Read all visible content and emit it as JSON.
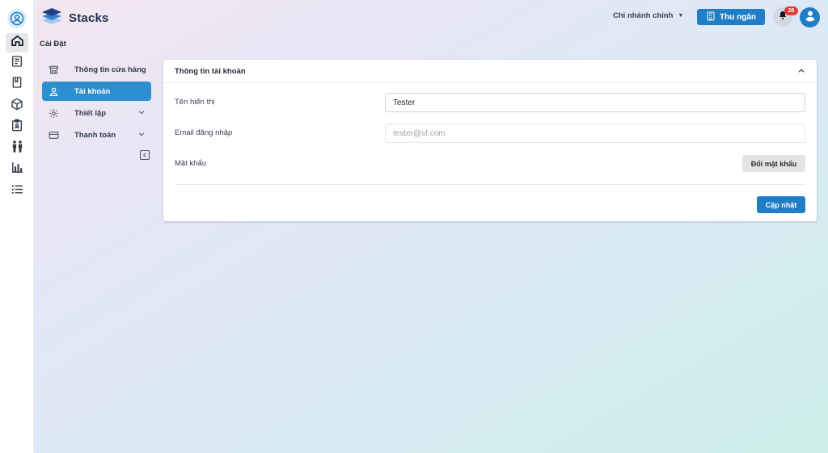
{
  "app": {
    "name": "Stacks"
  },
  "header": {
    "branch": "Chi nhánh chính",
    "cashier_label": "Thu ngân",
    "notification_count": "26"
  },
  "page": {
    "title": "Cài Đặt"
  },
  "settings_nav": {
    "items": [
      {
        "label": "Thông tin cửa hàng",
        "icon": "store-icon",
        "active": false
      },
      {
        "label": "Tài khoản",
        "icon": "user-icon",
        "active": true
      },
      {
        "label": "Thiết lập",
        "icon": "gear-icon",
        "active": false,
        "expandable": true
      },
      {
        "label": "Thanh toán",
        "icon": "card-icon",
        "active": false,
        "expandable": true
      }
    ]
  },
  "account_card": {
    "title": "Thông tin tài khoản",
    "display_name_label": "Tên hiển thị",
    "display_name_value": "Tester",
    "email_label": "Email đăng nhập",
    "email_placeholder": "tester@sf.com",
    "password_label": "Mật khẩu",
    "change_password_label": "Đổi mật khẩu",
    "update_label": "Cập nhật"
  },
  "colors": {
    "primary": "#1f7ec6",
    "active_nav": "#2e8fd0",
    "badge": "#e53935"
  }
}
